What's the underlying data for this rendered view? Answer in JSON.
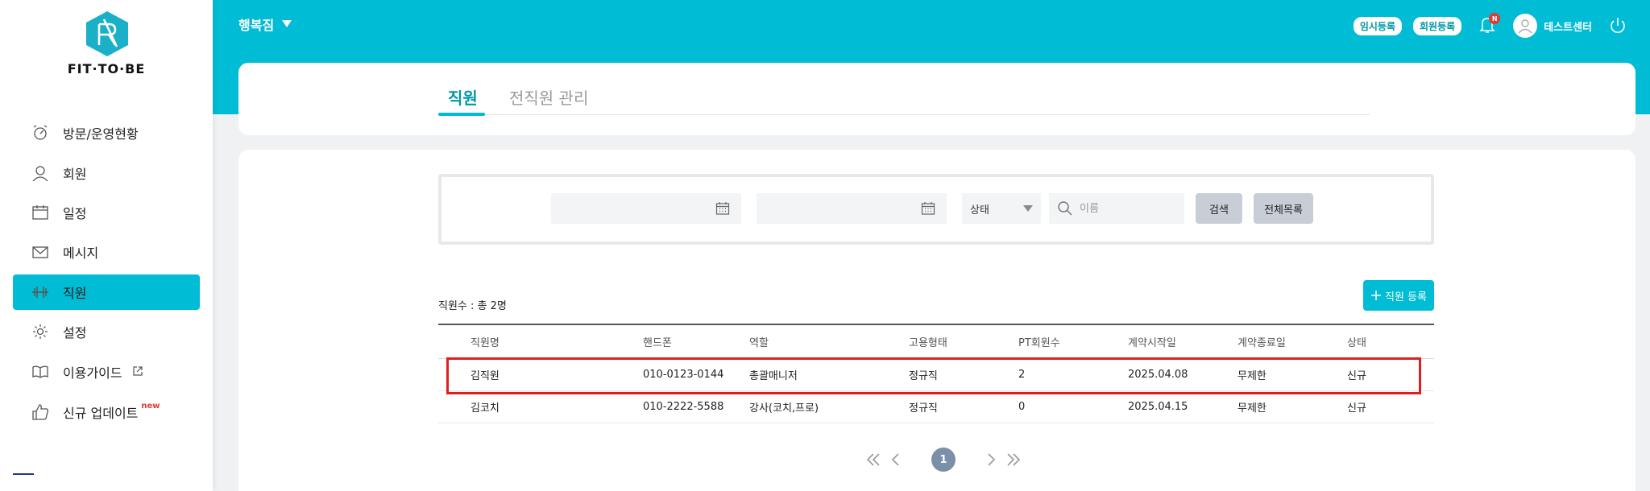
{
  "brand": {
    "logo_text": "FIT·TO·BE"
  },
  "sidebar": {
    "items": [
      {
        "label": "방문/운영현황",
        "icon": "visit-status-icon"
      },
      {
        "label": "회원",
        "icon": "member-icon"
      },
      {
        "label": "일정",
        "icon": "calendar-icon"
      },
      {
        "label": "메시지",
        "icon": "mail-icon"
      },
      {
        "label": "직원",
        "icon": "dumbbell-icon",
        "active": true
      },
      {
        "label": "설정",
        "icon": "gear-icon"
      },
      {
        "label": "이용가이드",
        "icon": "book-icon"
      },
      {
        "label": "신규 업데이트",
        "icon": "thumbs-up-icon",
        "badge": "new"
      }
    ]
  },
  "header": {
    "center_name": "행복짐",
    "temp_register": "임시등록",
    "member_register": "회원등록",
    "notification_badge": "N",
    "user_name": "테스트센터",
    "accent_color": "#00bcd4"
  },
  "tabs": [
    {
      "label": "직원",
      "active": true
    },
    {
      "label": "전직원 관리",
      "active": false
    }
  ],
  "filters": {
    "start_date": "",
    "end_date": "",
    "status_label": "상태",
    "name_placeholder": "이름",
    "search_label": "검색",
    "all_list_label": "전체목록"
  },
  "staff_count_label": "직원수 : 총 2명",
  "add_staff_label": "직원 등록",
  "table": {
    "headers": [
      "직원명",
      "핸드폰",
      "역할",
      "고용형태",
      "PT회원수",
      "계약시작일",
      "계약종료일",
      "상태"
    ],
    "rows": [
      [
        "김직원",
        "010-0123-0144",
        "총괄매니저",
        "정규직",
        "2",
        "2025.04.08",
        "무제한",
        "신규"
      ],
      [
        "김코치",
        "010-2222-5588",
        "강사(코치,프로)",
        "정규직",
        "0",
        "2025.04.15",
        "무제한",
        "신규"
      ]
    ]
  },
  "pagination": {
    "current_page": "1"
  }
}
